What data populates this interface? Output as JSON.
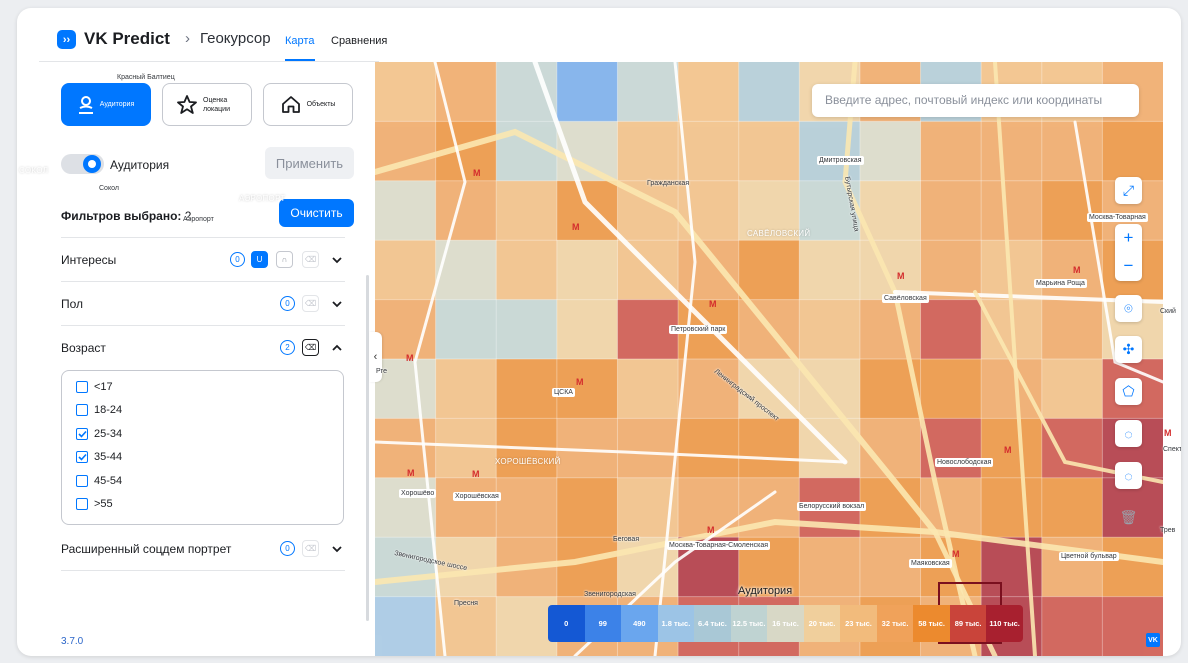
{
  "header": {
    "brand": "VK Predict",
    "separator": "›",
    "crumb": "Геокурсор",
    "tabs": [
      {
        "label": "Карта"
      },
      {
        "label": "Сравнения"
      }
    ]
  },
  "sidebar": {
    "modes": [
      {
        "label": "Аудитория",
        "icon": "person-icon"
      },
      {
        "label": "Оценка локации",
        "icon": "star-icon"
      },
      {
        "label": "Объекты",
        "icon": "home-icon"
      }
    ],
    "toggle_label": "Аудитория",
    "apply_label": "Применить",
    "filters_label": "Фильтров выбрано:",
    "filters_count": "2",
    "clear_label": "Очистить",
    "sections": [
      {
        "label": "Интересы",
        "count": "0",
        "union": "U",
        "intersect": "∩"
      },
      {
        "label": "Пол",
        "count": "0"
      },
      {
        "label": "Возраст",
        "count": "2"
      },
      {
        "label": "Расширенный соцдем портрет",
        "count": "0"
      }
    ],
    "age_options": [
      {
        "label": "<17",
        "checked": false
      },
      {
        "label": "18-24",
        "checked": false
      },
      {
        "label": "25-34",
        "checked": true
      },
      {
        "label": "35-44",
        "checked": true
      },
      {
        "label": "45-54",
        "checked": false
      },
      {
        "label": ">55",
        "checked": false
      }
    ],
    "version": "3.7.0"
  },
  "map": {
    "search_placeholder": "Введите адрес, почтовый индекс или координаты",
    "labels": [
      "Красный Балтиец",
      "Сокол",
      "СОКОЛ",
      "Аэропорт",
      "АЭРОПОРТ",
      "Гражданская",
      "Дмитровская",
      "Бутырская улица",
      "САВЁЛОВСКИЙ",
      "Москва-Товарная",
      "Савёловская",
      "Марьина Роща",
      "Петровский парк",
      "ЦСКА",
      "Ленинградский проспект",
      "ХОРОШЁВСКИЙ",
      "Хорошёво",
      "Хорошёвская",
      "Новослободская",
      "Белорусский вокзал",
      "Беговая",
      "Москва-Товарная-Смоленская",
      "Звенигородское шоссе",
      "Маяковская",
      "Цветной бульвар",
      "Пресня",
      "Звенигородская",
      "Рге",
      "Ский",
      "Спект",
      "Трев"
    ],
    "legend_title": "Аудитория",
    "legend": [
      {
        "label": "0",
        "color": "#1458d4"
      },
      {
        "label": "99",
        "color": "#3c82e8"
      },
      {
        "label": "490",
        "color": "#6aa6ee"
      },
      {
        "label": "1.8 тыс.",
        "color": "#9cc4e6"
      },
      {
        "label": "6.4 тыс.",
        "color": "#a9c8d6"
      },
      {
        "label": "12.5 тыс.",
        "color": "#bfd3d2"
      },
      {
        "label": "16 тыс.",
        "color": "#d8d8c6"
      },
      {
        "label": "20 тыс.",
        "color": "#f0cf9c"
      },
      {
        "label": "23 тыс.",
        "color": "#f2bb7c"
      },
      {
        "label": "32 тыс.",
        "color": "#f0a25a"
      },
      {
        "label": "58 тыс.",
        "color": "#ec8a2e"
      },
      {
        "label": "89 тыс.",
        "color": "#c9443a"
      },
      {
        "label": "110 тыс.",
        "color": "#a8202f"
      }
    ],
    "attribution": "VK"
  }
}
